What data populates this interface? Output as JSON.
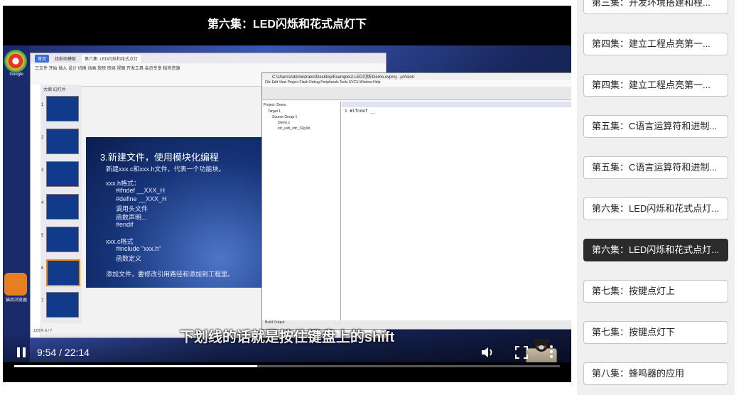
{
  "player": {
    "title": "第六集：LED闪烁和花式点灯下",
    "subtitle": "下划线的话就是按住键盘上的shift",
    "time": "9:54 / 22:14",
    "progress": 0.445
  },
  "screen": {
    "slide": {
      "title": "3.新建文件，使用模块化编程",
      "lines": [
        "新建xxx.c和xxx.h文件，代表一个功能块。",
        "xxx.h格式：",
        "#ifndef __XXX_H",
        "#define __XXX_H",
        "调用头文件",
        "函数声明...",
        "#endif",
        "xxx.c格式",
        "#include \"xxx.h\"",
        "函数定义",
        "添加文件，要修改引用路径和添加到工程里。"
      ]
    },
    "desktop": {
      "app1": "Google",
      "app2": "猫叔浏览器"
    },
    "ppt": {
      "tabs": [
        "首页",
        "找稻壳模板",
        "第六集: LED闪烁和花式点灯"
      ],
      "ribbon": "三文件 开始 插入 设计 切换 动画 放映 审阅 视图 开发工具 会员专享 稻壳资源",
      "thumb_tabs": "大纲  幻灯片",
      "page_info": "幻灯片 6 / 7"
    },
    "keil": {
      "title": "C:\\Users\\Administrator\\Desktop\\Example\\2.LED闪烁\\Demo.uvproj - µVision",
      "menu": "File  Edit  View  Project  Flash  Debug  Peripherals  Tools  SVCS  Window  Help",
      "tree": [
        "Project: Demo",
        "Target 1",
        "Source Group 1",
        "Demo.c",
        "stc_usb_cdc_32g.lib"
      ],
      "code": "1 #ifndef __",
      "output": "Build Output"
    }
  },
  "playlist": {
    "items": [
      {
        "label": "第三集：开发环境搭建和程...",
        "active": false
      },
      {
        "label": "第四集：建立工程点亮第一...",
        "active": false
      },
      {
        "label": "第四集：建立工程点亮第一...",
        "active": false
      },
      {
        "label": "第五集：C语言运算符和进制...",
        "active": false
      },
      {
        "label": "第五集：C语言运算符和进制...",
        "active": false
      },
      {
        "label": "第六集：LED闪烁和花式点灯...",
        "active": false
      },
      {
        "label": "第六集：LED闪烁和花式点灯...",
        "active": true
      },
      {
        "label": "第七集：按键点灯上",
        "active": false
      },
      {
        "label": "第七集：按键点灯下",
        "active": false
      },
      {
        "label": "第八集：蜂鸣器的应用",
        "active": false
      }
    ]
  },
  "colors": {
    "active_item_bg": "#2b2b2b",
    "progress_fill": "#ffffff",
    "player_bg": "#000000"
  }
}
